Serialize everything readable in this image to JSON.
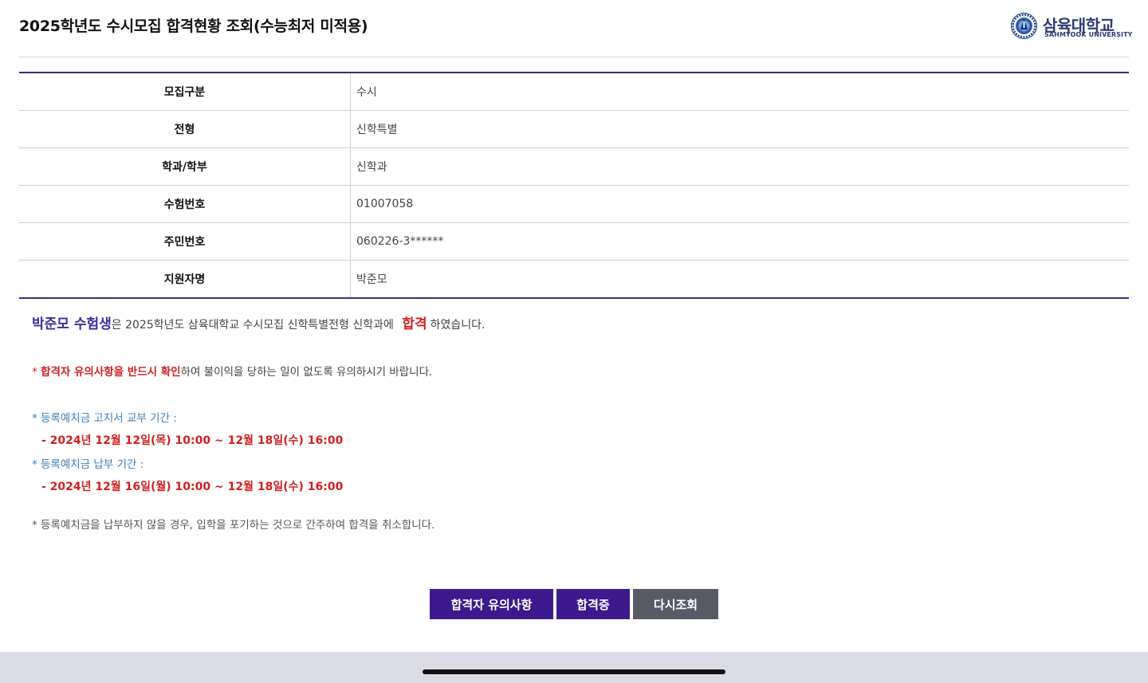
{
  "header": {
    "title": "2025학년도 수시모집 합격현황 조회(수능최저 미적용)",
    "logo_kr": "삼육대학교",
    "logo_en": "SAHMYOOK UNIVERSITY"
  },
  "info": {
    "rows": [
      {
        "label": "모집구분",
        "value": "수시"
      },
      {
        "label": "전형",
        "value": "신학특별"
      },
      {
        "label": "학과/학부",
        "value": "신학과"
      },
      {
        "label": "수험번호",
        "value": "01007058"
      },
      {
        "label": "주민번호",
        "value": "060226-3******"
      },
      {
        "label": "지원자명",
        "value": "박준모"
      }
    ]
  },
  "result": {
    "name": "박준모 수험생",
    "text_middle": "은 2025학년도 삼육대학교 수시모집 신학특별전형 신학과에",
    "pass": "합격",
    "text_end": "하였습니다."
  },
  "notices": {
    "warn_star": "* ",
    "warn_emphasis": "합격자 유의사항을 반드시 확인",
    "warn_rest": "하여 불이익을 당하는 일이  없도록 유의하시기 바랍니다.",
    "bill_label": "* 등록예치금 고지서 교부 기간 :",
    "bill_period": "- 2024년 12월 12일(목) 10:00 ~ 12월 18일(수) 16:00",
    "pay_label": "* 등록예치금 납부 기간 :",
    "pay_period": "- 2024년 12월 16일(월) 10:00 ~ 12월 18일(수) 16:00",
    "cancel_note": "* 등록예치금을 납부하지 않을 경우, 입학을 포기하는 것으로 간주하여 합격을 취소합니다."
  },
  "buttons": {
    "notice_label": "합격자 유의사항",
    "cert_label": "합격증",
    "retry_label": "다시조회"
  },
  "colors": {
    "accent": "#3c1a8d",
    "pass_red": "#d21f1f",
    "notice_blue": "#3a7fb8",
    "retry_gray": "#585b66"
  }
}
